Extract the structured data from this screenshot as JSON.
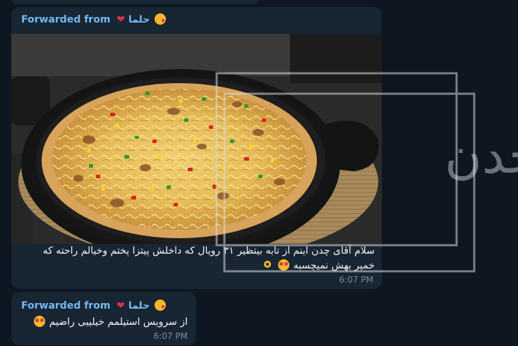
{
  "messages": [
    {
      "forwarded_label": "Forwarded from",
      "forwarded_name": "حلما",
      "media_alt": "pizza",
      "caption_line1": "سلام آقای چدن اینم از تابه بیتظیر ۳۱ رویال که داخلش پیتزا پختم وخیالم راحته که",
      "caption_line2": "خمیر بهش نمیچسبه",
      "time": "6:07 PM",
      "watermark_text": "آقای چدن"
    },
    {
      "forwarded_label": "Forwarded from",
      "forwarded_name": "حلما",
      "text": "از سرویس استیلمم خیلییی راضیم",
      "time": "6:07 PM"
    }
  ],
  "colors": {
    "background": "#0e1621",
    "bubble": "#182533",
    "forward_accent": "#71baf2",
    "timestamp": "#7d8e9e",
    "text": "#f5f5f5"
  },
  "icons": [
    "red-heart-icon",
    "kiss-face-icon",
    "heart-eyes-emoji",
    "ok-hand-emoji"
  ]
}
